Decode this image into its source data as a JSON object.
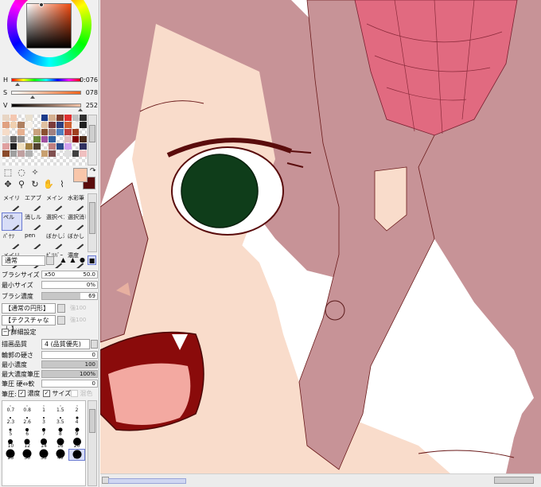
{
  "color_panel": {
    "h_label": "H",
    "h_value": "0:076",
    "s_label": "S",
    "s_value": "078",
    "v_label": "V",
    "v_value": "252",
    "foreground_color": "#f8c6aa",
    "background_color": "#5a0c0c",
    "swatches": [
      "#e8d5c4",
      "#f4c7b0",
      "",
      "#e9e0d0",
      "",
      "#1b3a8a",
      "#d4b090",
      "#7f3f2f",
      "#e03030",
      "#c0c0c0",
      "#303030",
      "#e0a080",
      "#f0d0b0",
      "#b08060",
      "#f6f0e8",
      "",
      "#e0c0a0",
      "#7b3a3a",
      "#2f3f7f",
      "#d06030",
      "#f0f0f0",
      "#202020",
      "#f6dcc8",
      "",
      "#e6b090",
      "",
      "#c9a27e",
      "#8a5030",
      "#a08080",
      "#5080c0",
      "#c04040",
      "#a04020",
      "",
      "#d8d8d8",
      "#606060",
      "#909090",
      "",
      "#6a8a3a",
      "#a050a0",
      "#3060a0",
      "",
      "#e0c0c0",
      "#800000",
      "#4a2a1a",
      "#e0a0a0",
      "#202020",
      "#f0e0c0",
      "#a08040",
      "#504030",
      "",
      "#c08080",
      "#2a4a8a",
      "#d0a0f0",
      "",
      "#303060",
      "#8a4a2a",
      "#a0a0a0",
      "#c0a0a0",
      "#b0b0b0",
      "",
      "#c8a070",
      "#805050",
      "",
      "#e0e0e0",
      "#404040",
      "#f0c0c0"
    ]
  },
  "tools": {
    "icons": [
      "select-rect-icon",
      "select-lasso-icon",
      "wand-icon",
      "",
      "",
      "move-icon",
      "zoom-icon",
      "rotate-icon",
      "hand-icon",
      "eyedropper-icon"
    ]
  },
  "brushes": [
    {
      "label": "メイリ",
      "selected": false
    },
    {
      "label": "エアブ",
      "selected": false
    },
    {
      "label": "メイン",
      "selected": false
    },
    {
      "label": "水彩筆",
      "selected": false
    },
    {
      "label": "ペル",
      "selected": true
    },
    {
      "label": "消しル",
      "selected": false
    },
    {
      "label": "選択ペン",
      "selected": false
    },
    {
      "label": "選択消し",
      "selected": false
    },
    {
      "label": "ﾊﾟｹﾂ",
      "selected": false
    },
    {
      "label": "pen",
      "selected": false
    },
    {
      "label": "ぼかし滲",
      "selected": false
    },
    {
      "label": "ぼかし",
      "selected": false
    },
    {
      "label": "メイリ",
      "selected": false
    },
    {
      "label": "",
      "selected": false
    },
    {
      "label": "ﾎﾟﾘﾊﾞｰ",
      "selected": false
    },
    {
      "label": "濃度",
      "selected": false
    }
  ],
  "blend_mode": "通常",
  "brush_params": {
    "brush_size_label": "ブラシサイズ",
    "brush_size_mult": "x50",
    "brush_size_value": "50.0",
    "min_size_label": "最小サイズ",
    "min_size_value": "0%",
    "density_label": "ブラシ濃度",
    "density_value": "69",
    "density_level": 0.69,
    "shape_label": "【通常の円形】",
    "shape_value": "100",
    "texture_label": "【テクスチャなし】",
    "texture_value": "100"
  },
  "advanced": {
    "section_label": "詳細設定",
    "quality_label": "描画品質",
    "quality_value": "4 (品質優先)",
    "edge_label": "輪郭の硬さ",
    "edge_value": "0",
    "min_density_label": "最小濃度",
    "min_density_value": "100",
    "min_density_level": 1.0,
    "max_pressure_label": "最大濃度筆圧",
    "max_pressure_value": "100%",
    "max_pressure_level": 1.0,
    "pressure_label": "筆圧 硬⇔軟",
    "pressure_value": "0",
    "pen_label": "筆圧:",
    "chk_density_label": "濃度",
    "chk_size_label": "サイズ",
    "chk_mix_label": "混色"
  },
  "brush_sizes": [
    {
      "label": "0.7",
      "d": 1
    },
    {
      "label": "0.8",
      "d": 1
    },
    {
      "label": "1",
      "d": 1
    },
    {
      "label": "1.5",
      "d": 1
    },
    {
      "label": "2",
      "d": 1
    },
    {
      "label": "2.3",
      "d": 2
    },
    {
      "label": "2.6",
      "d": 2
    },
    {
      "label": "3",
      "d": 2
    },
    {
      "label": "3.5",
      "d": 2
    },
    {
      "label": "4",
      "d": 3
    },
    {
      "label": "5",
      "d": 3
    },
    {
      "label": "6",
      "d": 4
    },
    {
      "label": "7",
      "d": 4
    },
    {
      "label": "8",
      "d": 5
    },
    {
      "label": "9",
      "d": 5
    },
    {
      "label": "10",
      "d": 6
    },
    {
      "label": "12",
      "d": 7
    },
    {
      "label": "14",
      "d": 8
    },
    {
      "label": "16",
      "d": 9
    },
    {
      "label": "20",
      "d": 10
    },
    {
      "label": "25",
      "d": 11
    },
    {
      "label": "30",
      "d": 11
    },
    {
      "label": "35",
      "d": 11
    },
    {
      "label": "40",
      "d": 11
    },
    {
      "label": "50",
      "d": 11
    }
  ],
  "selected_size": "50"
}
